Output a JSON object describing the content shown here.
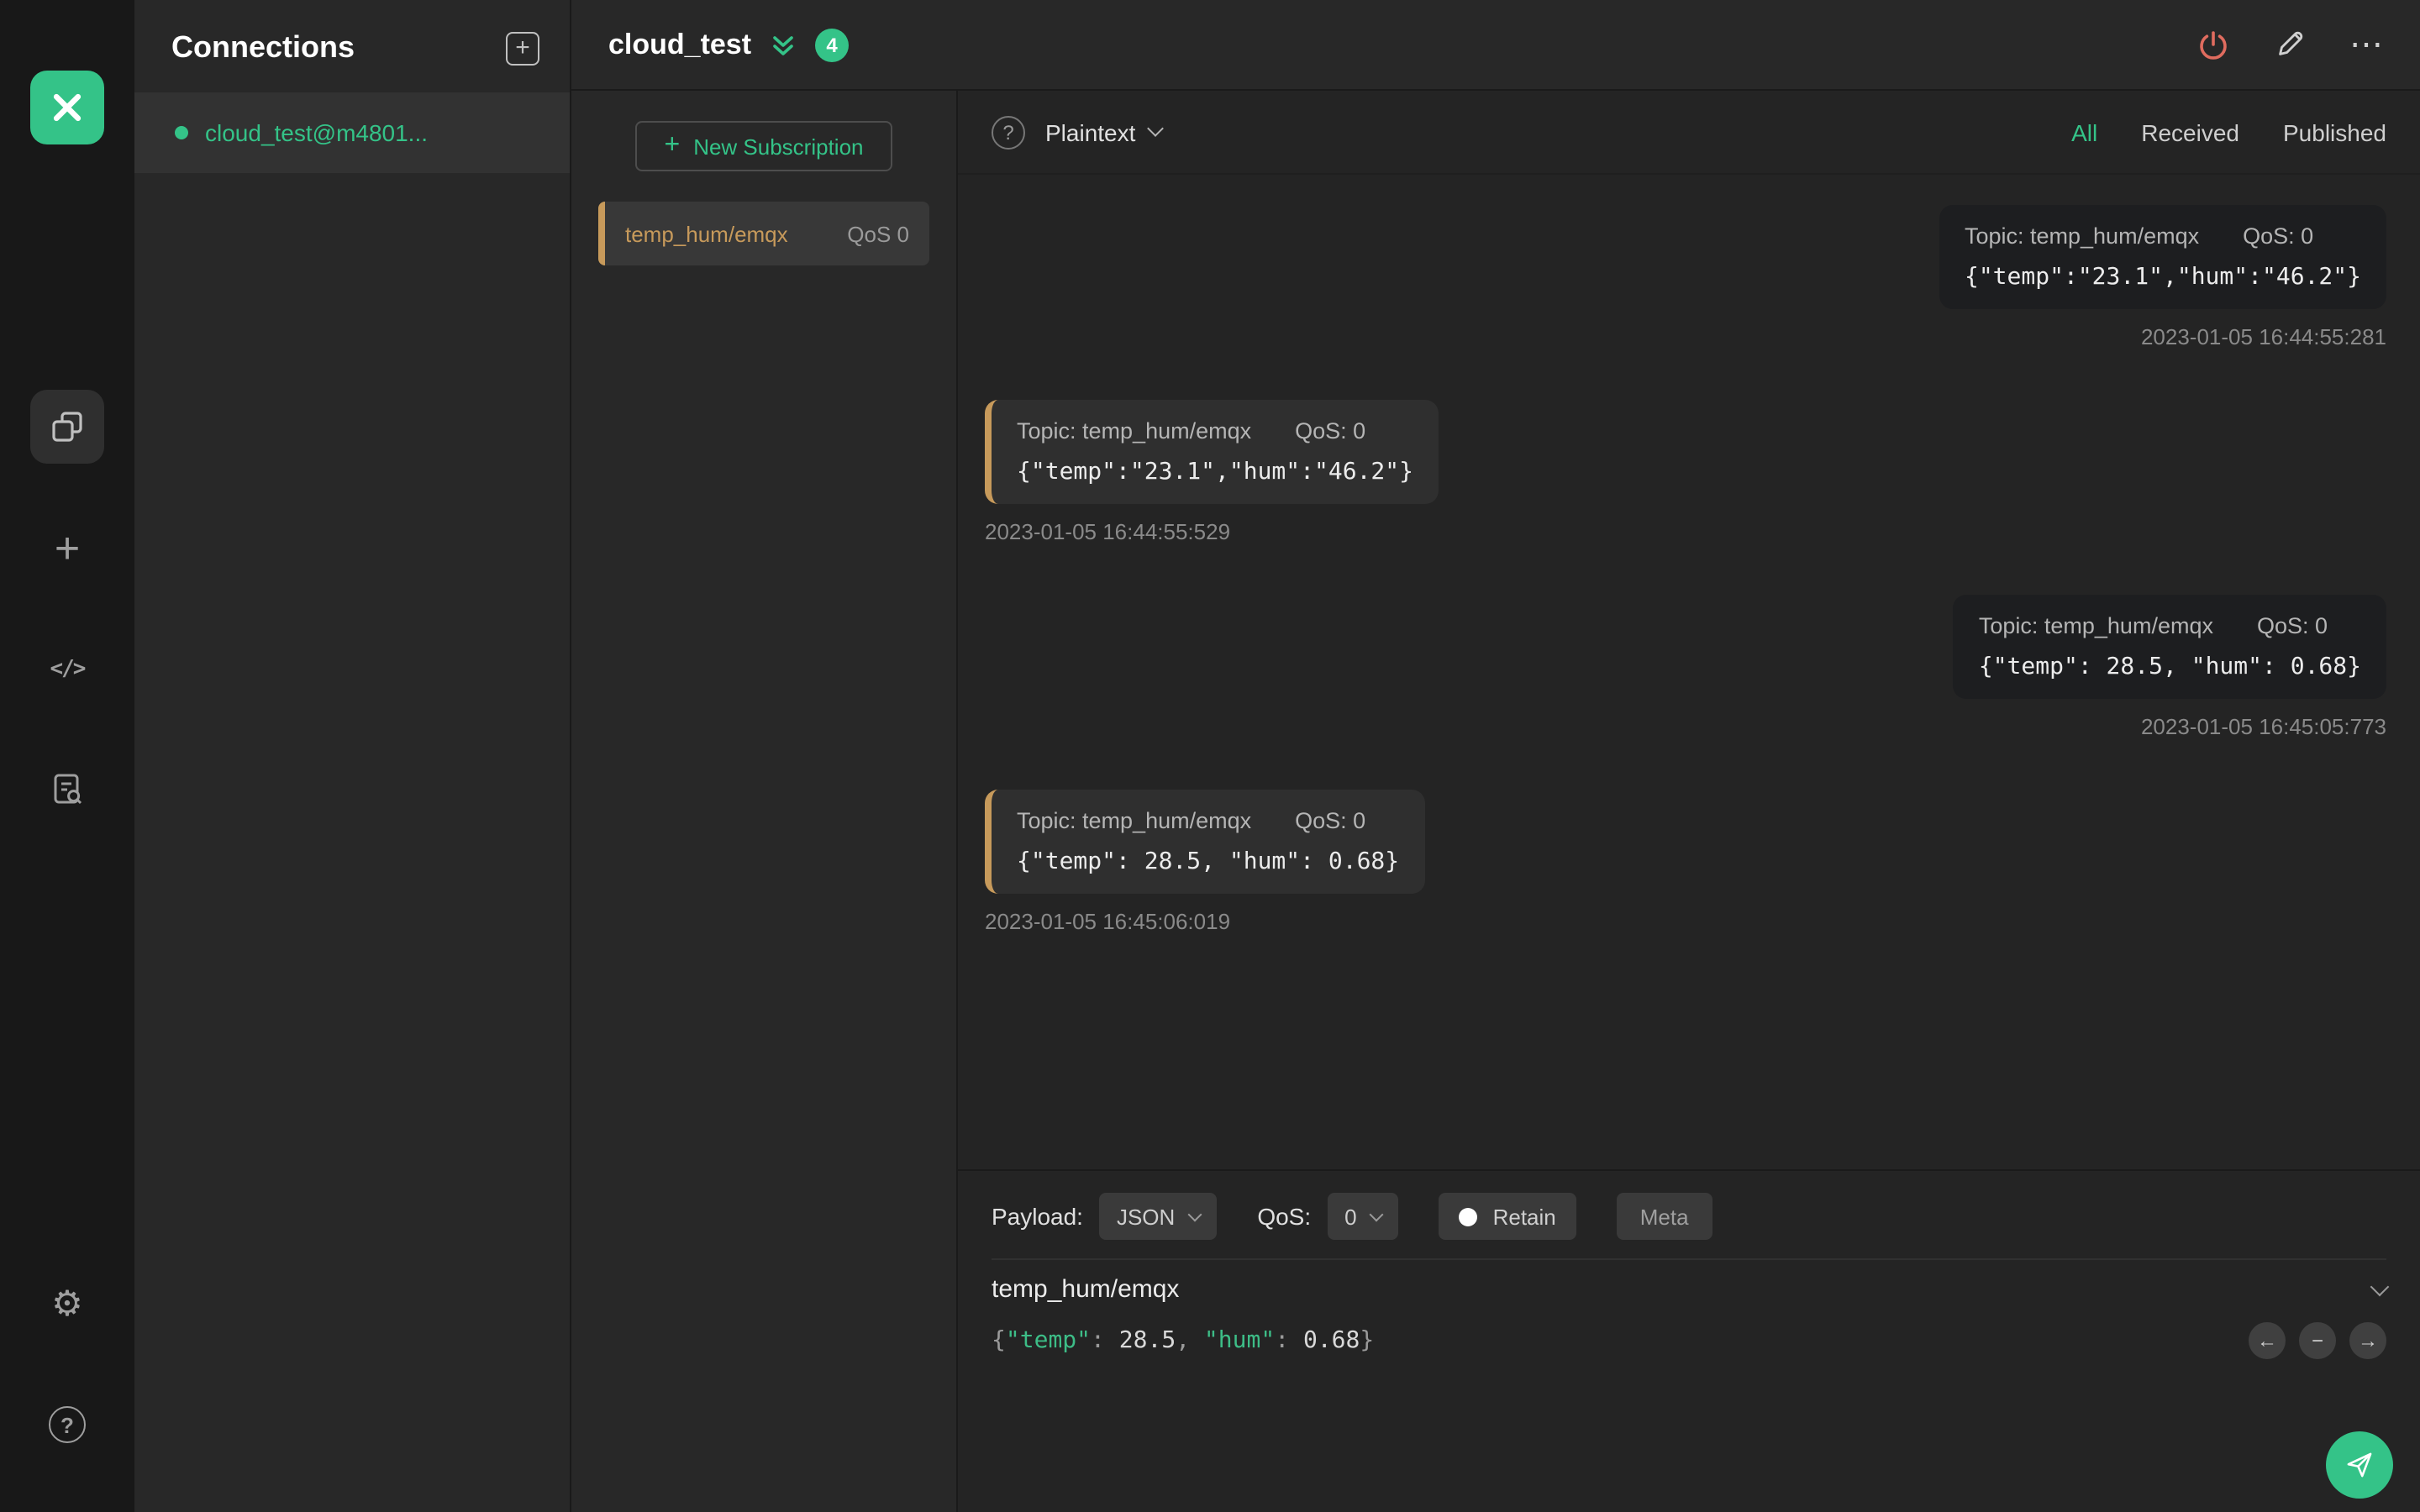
{
  "colors": {
    "green": "#34c388",
    "orange": "#c79a5b",
    "power_red": "#e06c5f"
  },
  "icons": {
    "plus": "+",
    "code": "</>",
    "gear": "⚙",
    "help": "?",
    "panel_plus": "+",
    "ellipsis": "⋯",
    "mini_help": "?",
    "pager_prev": "←",
    "pager_minus": "−",
    "pager_next": "→"
  },
  "connections": {
    "title": "Connections",
    "items": [
      {
        "label": "cloud_test@m4801...",
        "status": "connected"
      }
    ]
  },
  "header": {
    "title": "cloud_test",
    "badge_count": "4"
  },
  "subscriptions": {
    "new_button_label": "New Subscription",
    "items": [
      {
        "topic": "temp_hum/emqx",
        "qos": "QoS 0"
      }
    ]
  },
  "messages_toolbar": {
    "format": "Plaintext",
    "filters": {
      "all": "All",
      "received": "Received",
      "published": "Published"
    }
  },
  "messages": [
    {
      "side": "right",
      "topic": "Topic: temp_hum/emqx",
      "qos": "QoS: 0",
      "payload": "{\"temp\":\"23.1\",\"hum\":\"46.2\"}",
      "time": "2023-01-05 16:44:55:281"
    },
    {
      "side": "left",
      "topic": "Topic: temp_hum/emqx",
      "qos": "QoS: 0",
      "payload": "{\"temp\":\"23.1\",\"hum\":\"46.2\"}",
      "time": "2023-01-05 16:44:55:529"
    },
    {
      "side": "right",
      "topic": "Topic: temp_hum/emqx",
      "qos": "QoS: 0",
      "payload": "{\"temp\": 28.5, \"hum\": 0.68}",
      "time": "2023-01-05 16:45:05:773"
    },
    {
      "side": "left",
      "topic": "Topic: temp_hum/emqx",
      "qos": "QoS: 0",
      "payload": "{\"temp\": 28.5, \"hum\": 0.68}",
      "time": "2023-01-05 16:45:06:019"
    }
  ],
  "publish": {
    "payload_label": "Payload:",
    "payload_format": "JSON",
    "qos_label": "QoS:",
    "qos_value": "0",
    "retain_label": "Retain",
    "meta_label": "Meta",
    "topic": "temp_hum/emqx",
    "editor": {
      "p0": "{",
      "k1": "\"temp\"",
      "p2": ": ",
      "n3": "28.5",
      "p4": ", ",
      "k5": "\"hum\"",
      "p6": ": ",
      "n7": "0.68",
      "p8": "}"
    }
  }
}
